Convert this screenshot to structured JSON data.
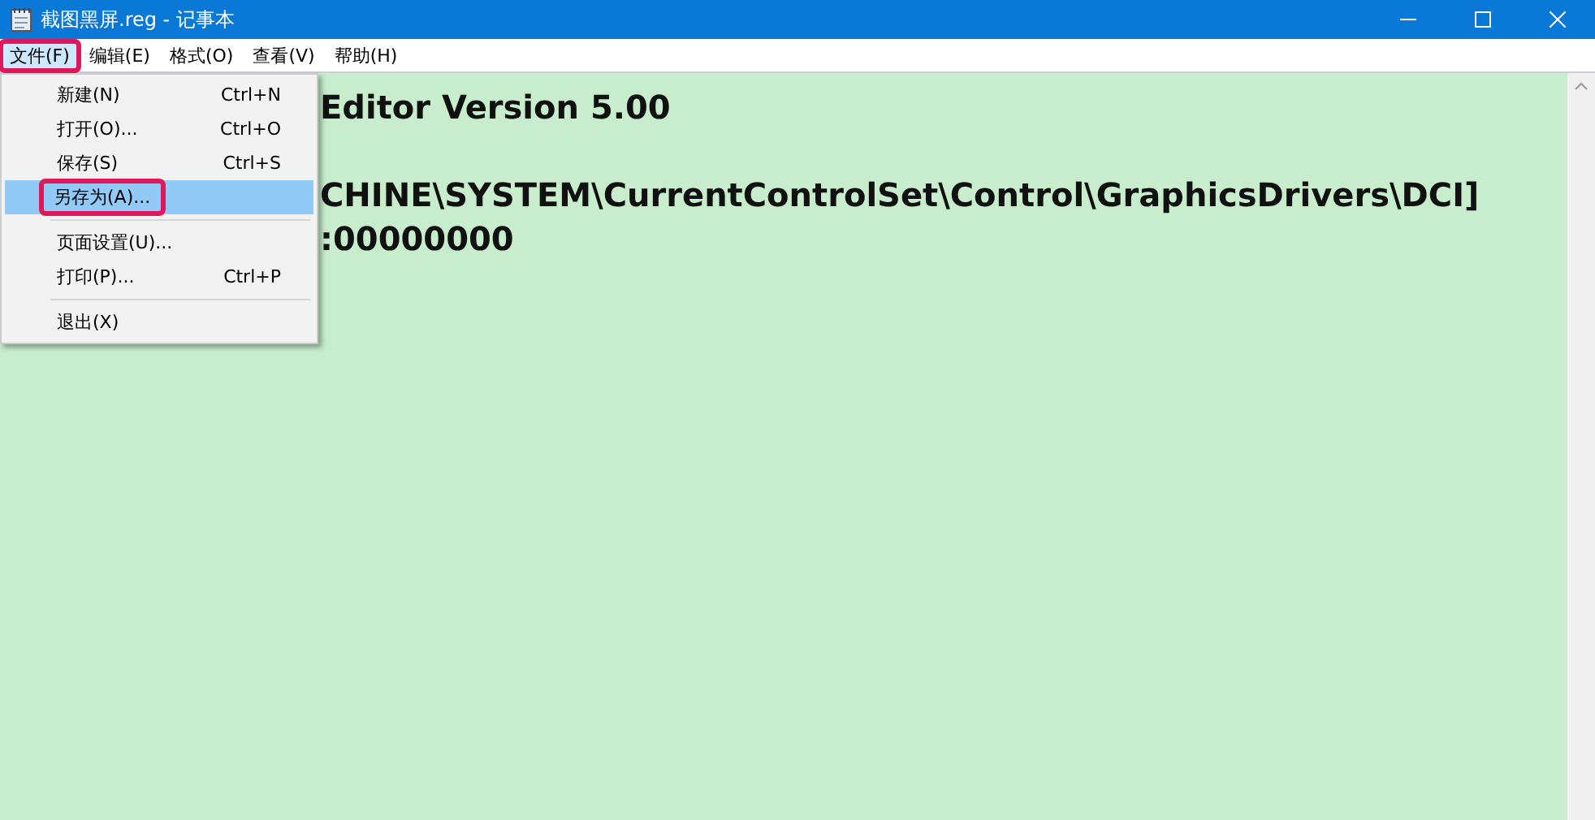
{
  "window": {
    "title": "截图黑屏.reg - 记事本"
  },
  "menu_bar": [
    {
      "label": "文件(F)",
      "selected": true,
      "marked": true
    },
    {
      "label": "编辑(E)",
      "selected": false,
      "marked": false
    },
    {
      "label": "格式(O)",
      "selected": false,
      "marked": false
    },
    {
      "label": "查看(V)",
      "selected": false,
      "marked": false
    },
    {
      "label": "帮助(H)",
      "selected": false,
      "marked": false
    }
  ],
  "file_menu": [
    {
      "kind": "item",
      "label": "新建(N)",
      "shortcut": "Ctrl+N",
      "selected": false,
      "marked": false
    },
    {
      "kind": "item",
      "label": "打开(O)...",
      "shortcut": "Ctrl+O",
      "selected": false,
      "marked": false
    },
    {
      "kind": "item",
      "label": "保存(S)",
      "shortcut": "Ctrl+S",
      "selected": false,
      "marked": false
    },
    {
      "kind": "item",
      "label": "另存为(A)...",
      "selected": true,
      "marked": true
    },
    {
      "kind": "separator"
    },
    {
      "kind": "item",
      "label": "页面设置(U)...",
      "selected": false,
      "marked": false
    },
    {
      "kind": "item",
      "label": "打印(P)...",
      "shortcut": "Ctrl+P",
      "selected": false,
      "marked": false
    },
    {
      "kind": "separator"
    },
    {
      "kind": "item",
      "label": "退出(X)",
      "selected": false,
      "marked": false
    }
  ],
  "editor": {
    "lines": [
      {
        "kind": "text",
        "text": "Editor Version 5.00"
      },
      {
        "kind": "blank"
      },
      {
        "kind": "text",
        "text": "CHINE\\SYSTEM\\CurrentControlSet\\Control\\GraphicsDrivers\\DCI]"
      },
      {
        "kind": "text",
        "text": ":00000000"
      }
    ]
  }
}
